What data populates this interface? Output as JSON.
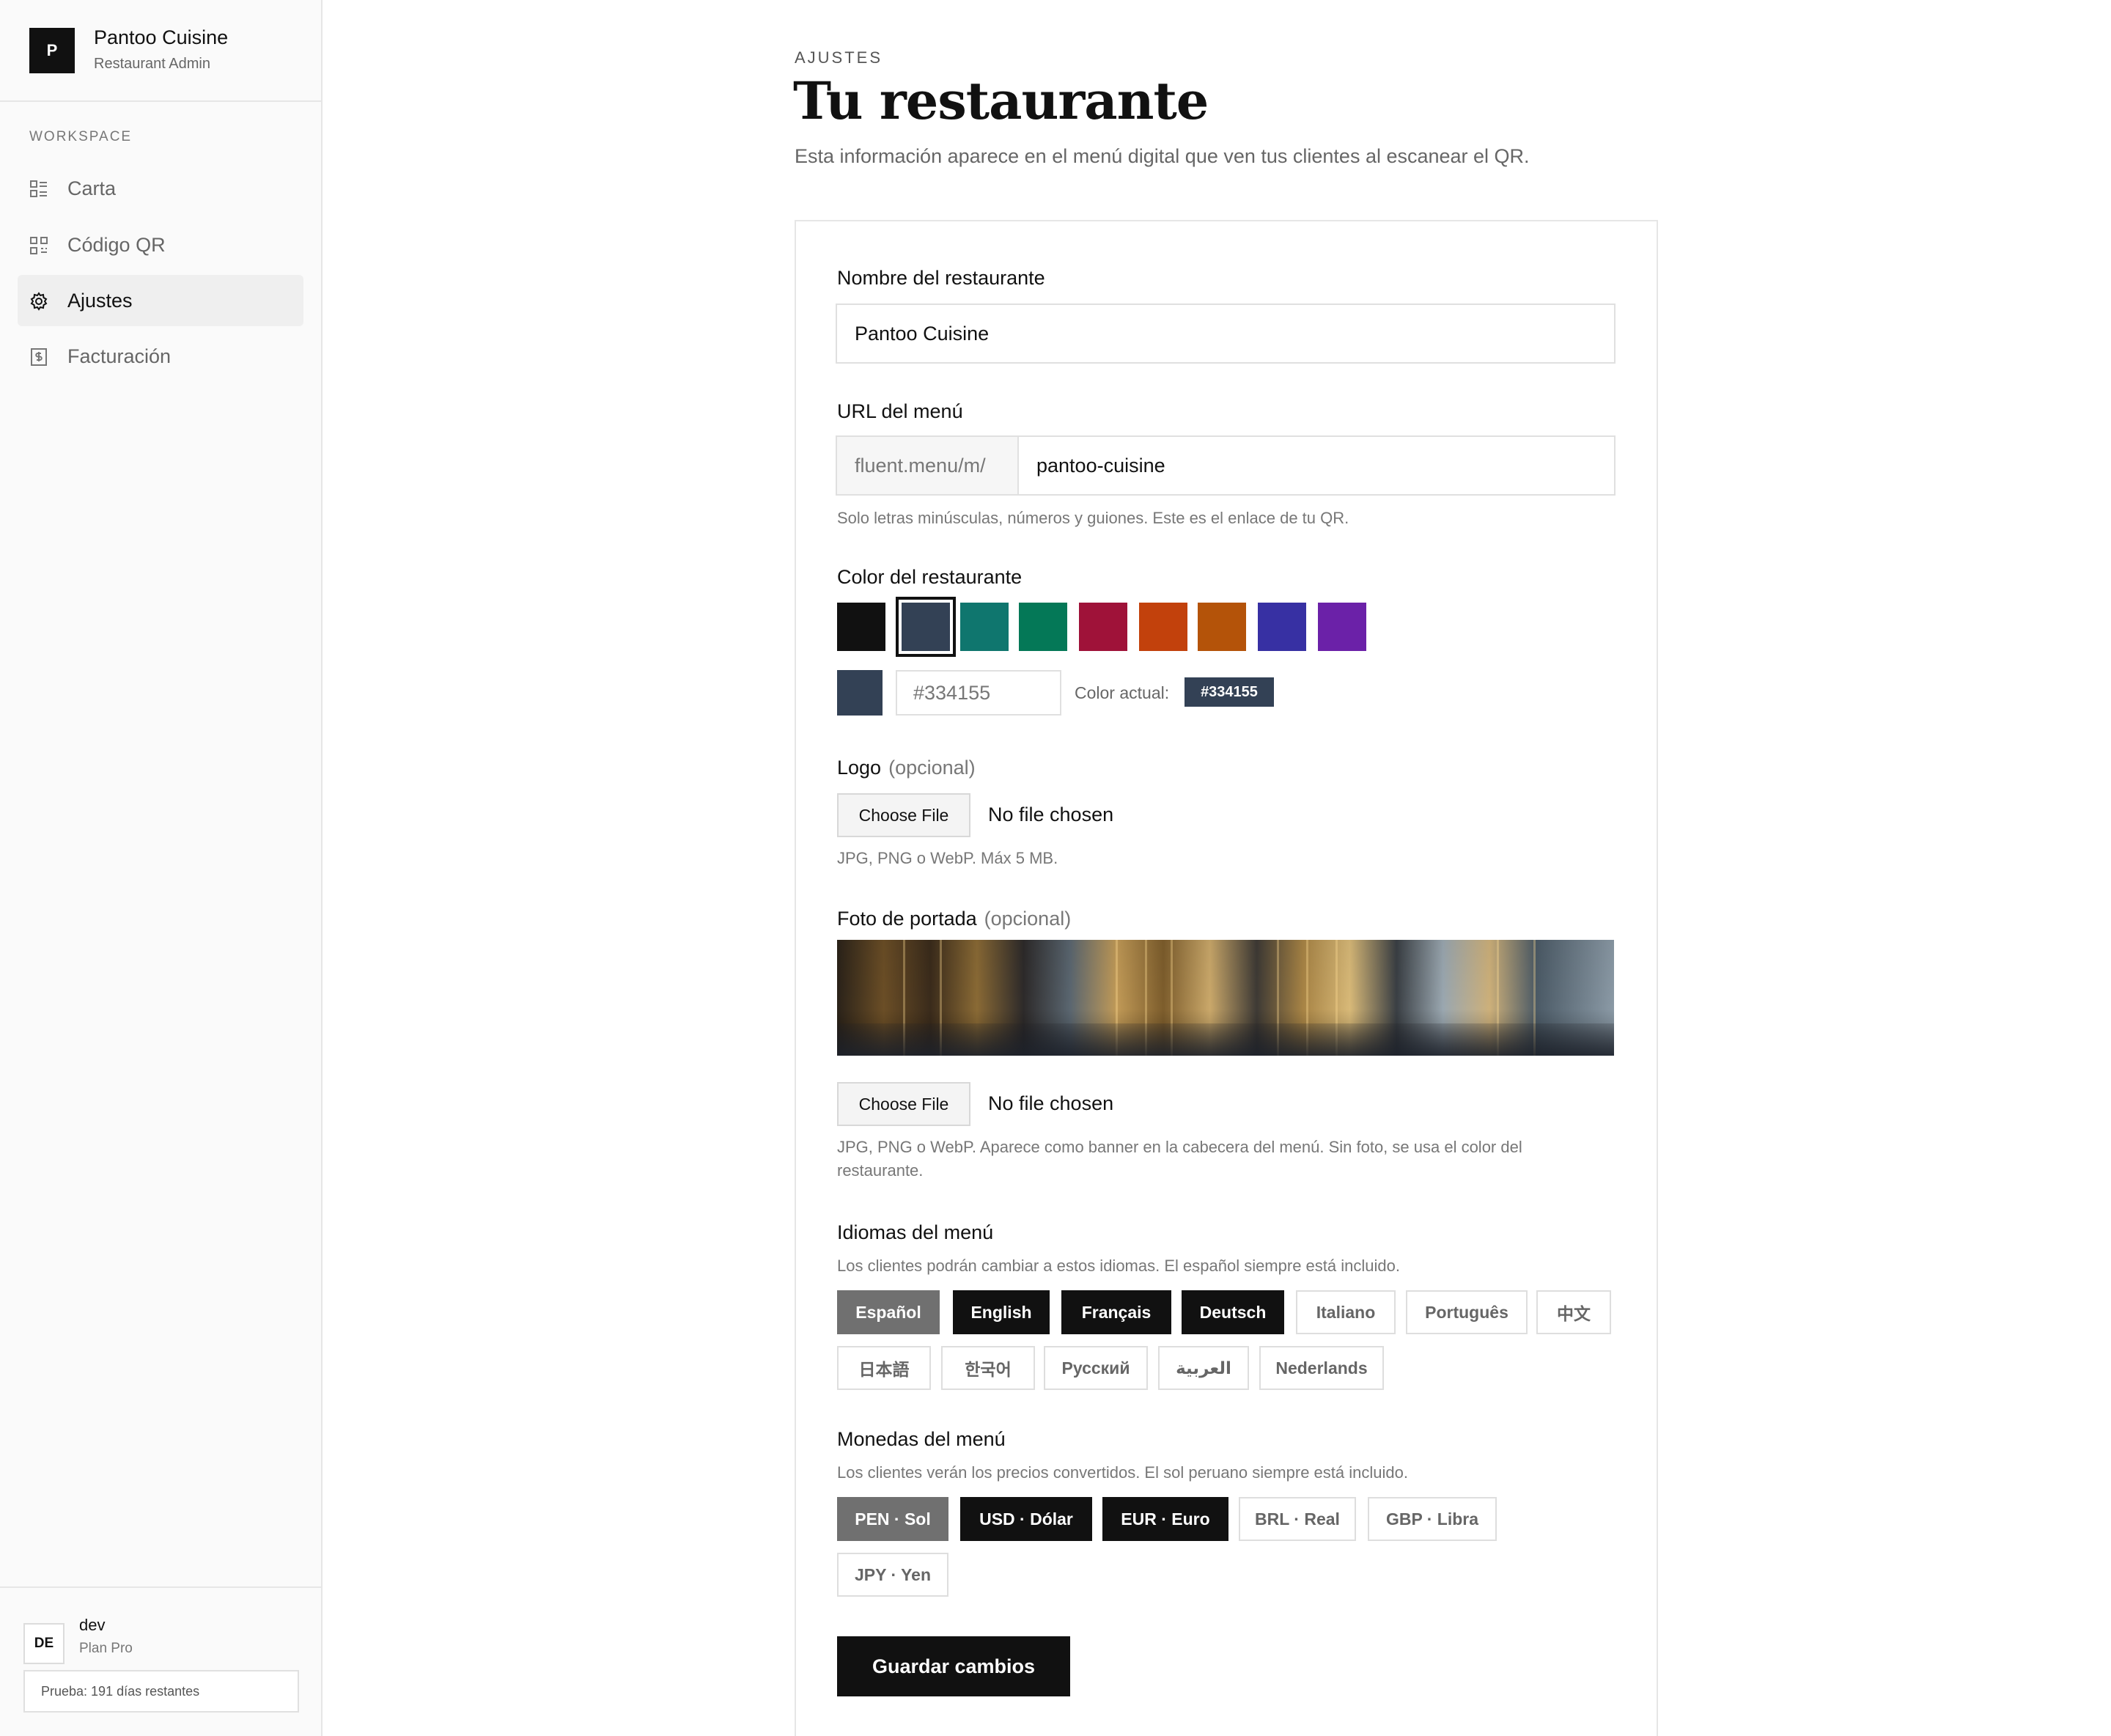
{
  "brand": {
    "logo_letter": "P",
    "name": "Pantoo Cuisine",
    "subtitle": "Restaurant Admin"
  },
  "sidebar": {
    "section_label": "WORKSPACE",
    "items": [
      {
        "label": "Carta",
        "icon": "menu-list-icon",
        "active": false
      },
      {
        "label": "Código QR",
        "icon": "qr-code-icon",
        "active": false
      },
      {
        "label": "Ajustes",
        "icon": "gear-icon",
        "active": true
      },
      {
        "label": "Facturación",
        "icon": "invoice-icon",
        "active": false
      }
    ],
    "user": {
      "initials": "DE",
      "name": "dev",
      "plan": "Plan Pro"
    },
    "trial": "Prueba: 191 días restantes"
  },
  "header": {
    "eyebrow": "AJUSTES",
    "title": "Tu restaurante",
    "description": "Esta información aparece en el menú digital que ven tus clientes al escanear el QR."
  },
  "form": {
    "name": {
      "label": "Nombre del restaurante",
      "value": "Pantoo Cuisine"
    },
    "url": {
      "label": "URL del menú",
      "prefix": "fluent.menu/m/",
      "value": "pantoo-cuisine",
      "hint": "Solo letras minúsculas, números y guiones. Este es el enlace de tu QR."
    },
    "color": {
      "label": "Color del restaurante",
      "swatches": [
        "#111111",
        "#334155",
        "#0f766e",
        "#047857",
        "#9f1239",
        "#c2410c",
        "#b45309",
        "#3730a3",
        "#6b21a8"
      ],
      "selected": "#334155",
      "hex_value": "#334155",
      "actual_label": "Color actual:",
      "actual_value": "#334155"
    },
    "logo": {
      "label": "Logo",
      "optional": "(opcional)",
      "button": "Choose File",
      "status": "No file chosen",
      "hint": "JPG, PNG o WebP. Máx 5 MB."
    },
    "cover": {
      "label": "Foto de portada",
      "optional": "(opcional)",
      "button": "Choose File",
      "status": "No file chosen",
      "hint_line1": "JPG, PNG o WebP. Aparece como banner en la cabecera del menú. Sin foto, se usa el color del",
      "hint_line2": "restaurante."
    },
    "languages": {
      "label": "Idiomas del menú",
      "hint": "Los clientes podrán cambiar a estos idiomas. El español siempre está incluido.",
      "options": [
        {
          "label": "Español",
          "state": "base"
        },
        {
          "label": "English",
          "state": "on"
        },
        {
          "label": "Français",
          "state": "on"
        },
        {
          "label": "Deutsch",
          "state": "on"
        },
        {
          "label": "Italiano",
          "state": "off"
        },
        {
          "label": "Português",
          "state": "off"
        },
        {
          "label": "中文",
          "state": "off"
        },
        {
          "label": "日本語",
          "state": "off"
        },
        {
          "label": "한국어",
          "state": "off"
        },
        {
          "label": "Русский",
          "state": "off"
        },
        {
          "label": "العربية",
          "state": "off"
        },
        {
          "label": "Nederlands",
          "state": "off"
        }
      ]
    },
    "currencies": {
      "label": "Monedas del menú",
      "hint": "Los clientes verán los precios convertidos. El sol peruano siempre está incluido.",
      "options": [
        {
          "label": "PEN · Sol",
          "state": "base"
        },
        {
          "label": "USD · Dólar",
          "state": "on"
        },
        {
          "label": "EUR · Euro",
          "state": "on"
        },
        {
          "label": "BRL · Real",
          "state": "off"
        },
        {
          "label": "GBP · Libra",
          "state": "off"
        },
        {
          "label": "JPY · Yen",
          "state": "off"
        }
      ]
    },
    "save_label": "Guardar cambios"
  }
}
